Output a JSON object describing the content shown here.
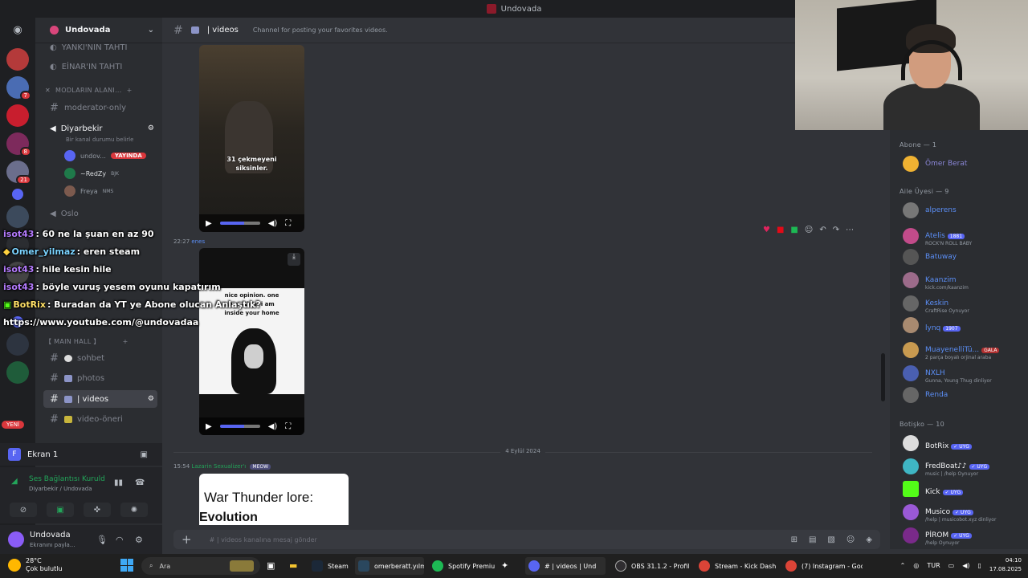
{
  "titlebar": {
    "title": "Undovada"
  },
  "server": {
    "name": "Undovada",
    "rail_badges": [
      "7",
      "8",
      "21"
    ],
    "new_label": "YENİ"
  },
  "sidebar": {
    "top1": "YANKI'NIN TAHTI",
    "top2": "EİNAR'IN TAHTI",
    "cat_mods": "MODLARIN ALANI...",
    "moderator_only": "moderator-only",
    "voice_diyarbekir": "Diyarbekir",
    "voice_status": "Bir kanal durumu belirle",
    "vc_users": [
      {
        "name": "undov...",
        "badge": "YAYINDA"
      },
      {
        "name": "~RedZy",
        "badge": "BJK"
      },
      {
        "name": "Freya",
        "badge": "NMS"
      }
    ],
    "oslo": "Oslo",
    "cat_main": "【 MAIN HALL 】",
    "channels": [
      {
        "name": "sohbet"
      },
      {
        "name": "photos"
      },
      {
        "name": "| videos"
      },
      {
        "name": "video-öneri"
      }
    ]
  },
  "screenshare": {
    "label": "Ekran 1",
    "letter": "F"
  },
  "voicepanel": {
    "status": "Ses Bağlantısı Kuruld",
    "location": "Diyarbekir / Undovada"
  },
  "userpanel": {
    "name": "Undovada",
    "status": "Ekranını payla..."
  },
  "chat": {
    "channel": "| videos",
    "topic": "Channel for posting your favorites videos.",
    "video1_caption1": "31 çekmeyeni",
    "video1_caption2": "siksinler.",
    "msg2_time": "22:27",
    "msg2_user": "enes",
    "video2_text1": "nice opinion. one",
    "video2_text2": "question. i am",
    "video2_text3": "inside your home",
    "date_sep": "4 Eylül 2024",
    "msg3_time": "15:54",
    "msg3_user": "Lazarin Sexualizer'ı",
    "msg3_tag": "MEOW",
    "video3_title1": "War Thunder lore:",
    "video3_title2": "Evolution",
    "composer_placeholder": "# | videos kanalına mesaj gönder"
  },
  "members": {
    "abone_header": "Abone — 1",
    "abone": [
      {
        "name": "Ömer Berat"
      }
    ],
    "aile_header": "Aile Üyesi — 9",
    "aile": [
      {
        "name": "alperens",
        "activity": ""
      },
      {
        "name": "Atelis",
        "activity": "ROCK'N ROLL BABY",
        "tag": "1881"
      },
      {
        "name": "Batuway",
        "activity": ""
      },
      {
        "name": "Kaanzim",
        "activity": "kick.com/kaanzim"
      },
      {
        "name": "Keskin",
        "activity": "CraftRise Oynuyor"
      },
      {
        "name": "lynq",
        "activity": "",
        "tag": "1907"
      },
      {
        "name": "MuayenelliTü...",
        "activity": "2 parça boyalı orjinal araba",
        "tag": "GALA"
      },
      {
        "name": "NXLH",
        "activity": "Gunna, Young Thug dinliyor"
      },
      {
        "name": "Renda",
        "activity": ""
      }
    ],
    "bot_header": "Botişko — 10",
    "bots": [
      {
        "name": "BotRix",
        "activity": "",
        "tag": "✓ UYG"
      },
      {
        "name": "FredBoat♪♪",
        "activity": "music | /help Oynuyor",
        "tag": "✓ UYG"
      },
      {
        "name": "Kick",
        "activity": "",
        "tag": "✓ UYG"
      },
      {
        "name": "Musico",
        "activity": "/help | musicobot.xyz dinliyor",
        "tag": "✓ UYG"
      },
      {
        "name": "PİROM",
        "activity": "/help Oynuyor",
        "tag": "✓ UYG"
      }
    ]
  },
  "overlay": {
    "lines": [
      {
        "user": "isot43",
        "text": ": 60 ne la şuan en az 90"
      },
      {
        "user": "Omer_yilmaz",
        "text": ": eren steam"
      },
      {
        "user": "isot43",
        "text": ": hile kesin hile"
      },
      {
        "user": "isot43",
        "text": ": böyle vuruş yesem oyunu kapatırım"
      },
      {
        "user": "BotRix",
        "text": ": Buradan da YT ye Abone olucan Anlaştık?"
      }
    ],
    "link": "https://www.youtube.com/@undovadaa"
  },
  "taskbar": {
    "temp": "28°C",
    "weather": "Çok bulutlu",
    "search": "Ara",
    "items": [
      "Steam",
      "omerberatt.yılm",
      "Spotify Premiu",
      "# | videos | Und",
      "OBS 31.1.2 - Profil: o",
      "Stream - Kick Dashb",
      "(7) Instagram - Goo"
    ],
    "lang": "TUR",
    "time": "04:10",
    "date": "17.08.2025"
  },
  "colors": {
    "accent": "#5865f2",
    "live": "#da373c",
    "online": "#23a55a",
    "bg": "#313338"
  }
}
